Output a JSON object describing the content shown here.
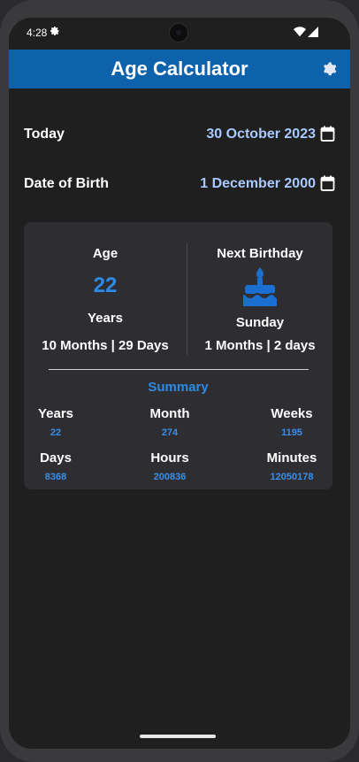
{
  "status": {
    "time": "4:28"
  },
  "appbar": {
    "title": "Age Calculator"
  },
  "today": {
    "label": "Today",
    "value": "30 October 2023"
  },
  "dob": {
    "label": "Date of Birth",
    "value": "1 December 2000"
  },
  "age": {
    "heading": "Age",
    "number": "22",
    "unit": "Years",
    "detail": "10 Months | 29 Days"
  },
  "next_birthday": {
    "heading": "Next Birthday",
    "weekday": "Sunday",
    "detail": "1 Months | 2 days"
  },
  "summary": {
    "title": "Summary",
    "stats": [
      {
        "label": "Years",
        "value": "22"
      },
      {
        "label": "Month",
        "value": "274"
      },
      {
        "label": "Weeks",
        "value": "1195"
      },
      {
        "label": "Days",
        "value": "8368"
      },
      {
        "label": "Hours",
        "value": "200836"
      },
      {
        "label": "Minutes",
        "value": "12050178"
      }
    ]
  },
  "colors": {
    "appbar": "#0d62ab",
    "accent": "#2d8ae6",
    "date_value": "#a9c9ff",
    "background": "#1f1f1f",
    "card": "#2e2e32"
  },
  "icons": [
    "settings-gear-icon",
    "calendar-icon",
    "birthday-cake-icon",
    "wifi-icon",
    "signal-icon"
  ]
}
